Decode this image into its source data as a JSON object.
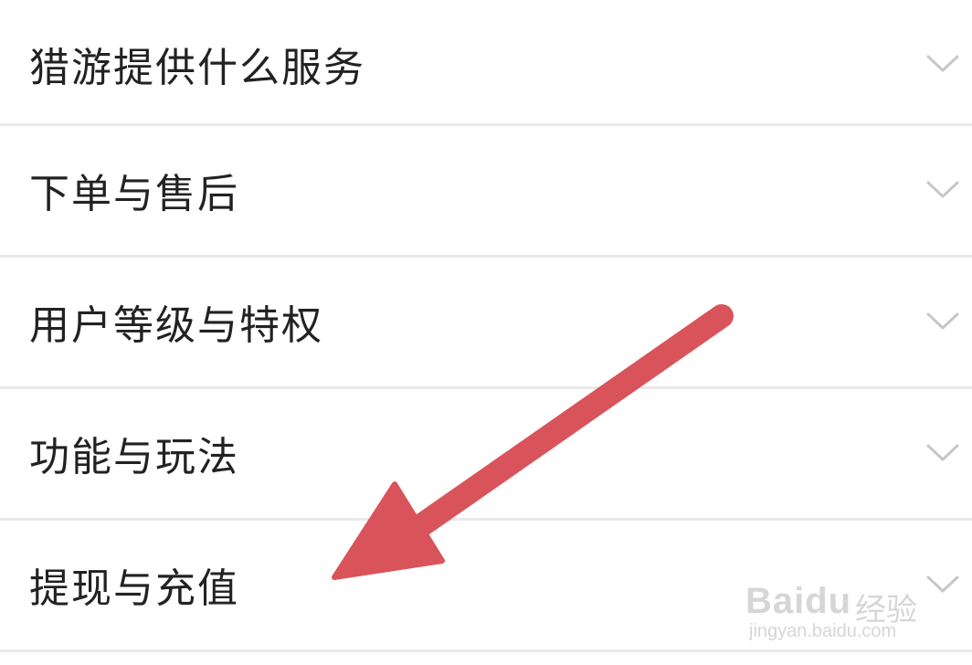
{
  "faq": {
    "items": [
      {
        "label": "猎游提供什么服务",
        "icon": "chevron-down-icon"
      },
      {
        "label": "下单与售后",
        "icon": "chevron-down-icon"
      },
      {
        "label": "用户等级与特权",
        "icon": "chevron-down-icon"
      },
      {
        "label": "功能与玩法",
        "icon": "chevron-down-icon"
      },
      {
        "label": "提现与充值",
        "icon": "chevron-down-icon"
      }
    ]
  },
  "annotation": {
    "arrow_color": "#d9545a",
    "icon": "arrow-icon"
  },
  "watermark": {
    "brand": "Baidu",
    "suffix": "经验",
    "url": "jingyan.baidu.com"
  },
  "colors": {
    "text": "#222222",
    "chevron": "#c7c7c7",
    "divider": "#e9e9e9"
  }
}
